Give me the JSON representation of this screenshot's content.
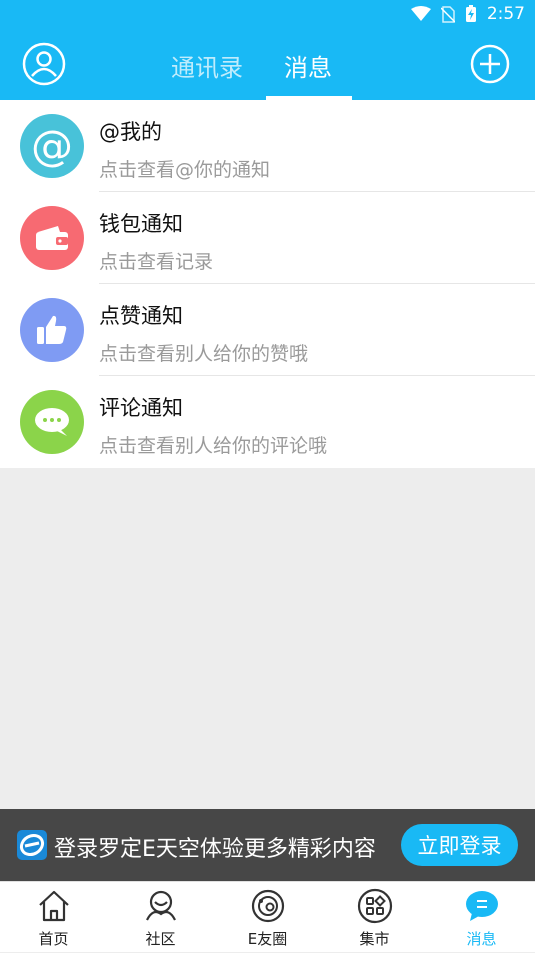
{
  "status_bar": {
    "time": "2:57",
    "icons": [
      "wifi-icon",
      "no-sim-icon",
      "battery-charging-icon"
    ]
  },
  "header": {
    "left_icon": "user-avatar-icon",
    "right_icon": "add-circle-icon",
    "tabs": [
      {
        "label": "通讯录",
        "active": false
      },
      {
        "label": "消息",
        "active": true
      }
    ],
    "background_color": "#19b9f5"
  },
  "notifications": [
    {
      "title": "@我的",
      "subtitle": "点击查看@你的通知",
      "icon": "at-icon",
      "color": "#48c2d9"
    },
    {
      "title": "钱包通知",
      "subtitle": "点击查看记录",
      "icon": "wallet-icon",
      "color": "#f76a72"
    },
    {
      "title": "点赞通知",
      "subtitle": "点击查看别人给你的赞哦",
      "icon": "thumbs-up-icon",
      "color": "#7f9bf3"
    },
    {
      "title": "评论通知",
      "subtitle": "点击查看别人给你的评论哦",
      "icon": "chat-bubble-icon",
      "color": "#8bd44a"
    }
  ],
  "login_banner": {
    "text": "登录罗定E天空体验更多精彩内容",
    "button_label": "立即登录",
    "logo_icon": "app-logo-icon"
  },
  "bottom_nav": [
    {
      "label": "首页",
      "icon": "home-icon",
      "active": false
    },
    {
      "label": "社区",
      "icon": "community-icon",
      "active": false
    },
    {
      "label": "E友圈",
      "icon": "friends-circle-icon",
      "active": false
    },
    {
      "label": "集市",
      "icon": "market-icon",
      "active": false
    },
    {
      "label": "消息",
      "icon": "message-icon",
      "active": true
    }
  ]
}
